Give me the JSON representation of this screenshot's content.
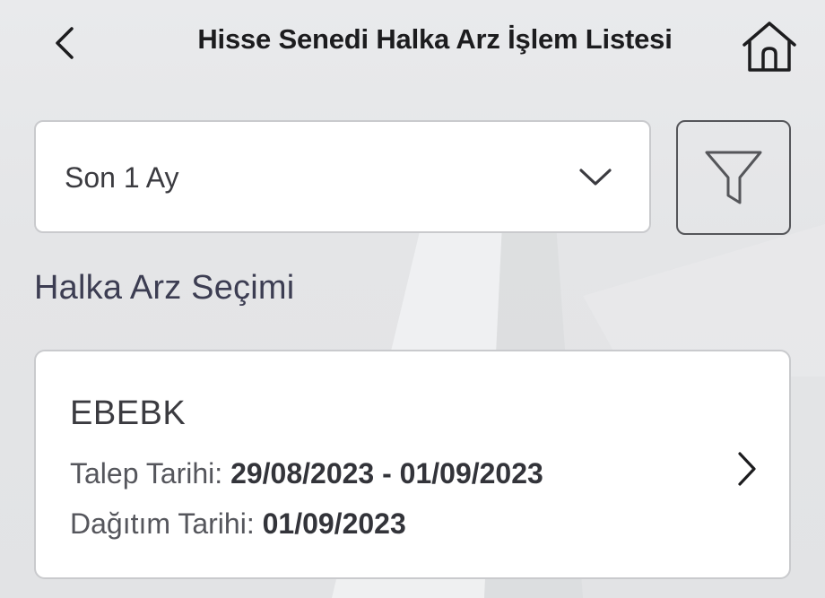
{
  "header": {
    "title": "Hisse Senedi Halka Arz İşlem Listesi",
    "back_icon": "chevron-left-icon",
    "home_icon": "home-icon"
  },
  "filter": {
    "period_selected": "Son 1 Ay",
    "dropdown_icon": "chevron-down-icon",
    "filter_icon": "funnel-icon"
  },
  "section": {
    "title": "Halka Arz Seçimi"
  },
  "offerings": [
    {
      "code": "EBEBK",
      "request_date_label": "Talep Tarihi:",
      "request_date_value": "29/08/2023 - 01/09/2023",
      "distribution_date_label": "Dağıtım Tarihi:",
      "distribution_date_value": "01/09/2023"
    }
  ],
  "colors": {
    "background": "#e4e5e7",
    "card": "#ffffff",
    "border": "#c9cacd",
    "title_text": "#1c1c1e",
    "section_text": "#3c3d52"
  }
}
